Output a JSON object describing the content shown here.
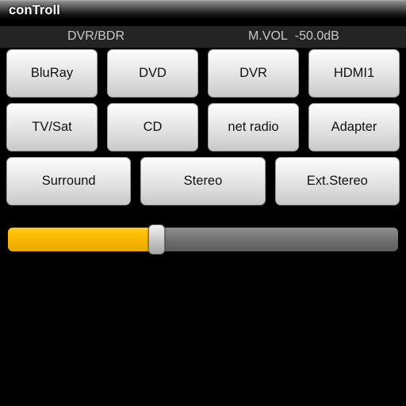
{
  "window": {
    "title": "conTroll"
  },
  "status": {
    "source": "DVR/BDR",
    "volume_label": "M.VOL",
    "volume_value": "-50.0dB"
  },
  "buttons": {
    "rows": [
      [
        {
          "label": "BluRay",
          "name": "bluray"
        },
        {
          "label": "DVD",
          "name": "dvd"
        },
        {
          "label": "DVR",
          "name": "dvr"
        },
        {
          "label": "HDMI1",
          "name": "hdmi1"
        }
      ],
      [
        {
          "label": "TV/Sat",
          "name": "tv-sat"
        },
        {
          "label": "CD",
          "name": "cd"
        },
        {
          "label": "net radio",
          "name": "net-radio"
        },
        {
          "label": "Adapter",
          "name": "adapter"
        }
      ],
      [
        {
          "label": "Surround",
          "name": "surround"
        },
        {
          "label": "Stereo",
          "name": "stereo"
        },
        {
          "label": "Ext.Stereo",
          "name": "ext-stereo"
        }
      ]
    ]
  },
  "slider": {
    "name": "master-volume-slider",
    "percent": 38,
    "fill_color": "#f5b400",
    "track_color": "#6c6c6c",
    "thumb_color": "#cfcfcf"
  },
  "colors": {
    "background": "#000000",
    "statusbar": "#242424",
    "status_text": "#c8c8c8",
    "button_face": "#e6e6e6",
    "button_text": "#121212",
    "title_text": "#ffffff"
  }
}
